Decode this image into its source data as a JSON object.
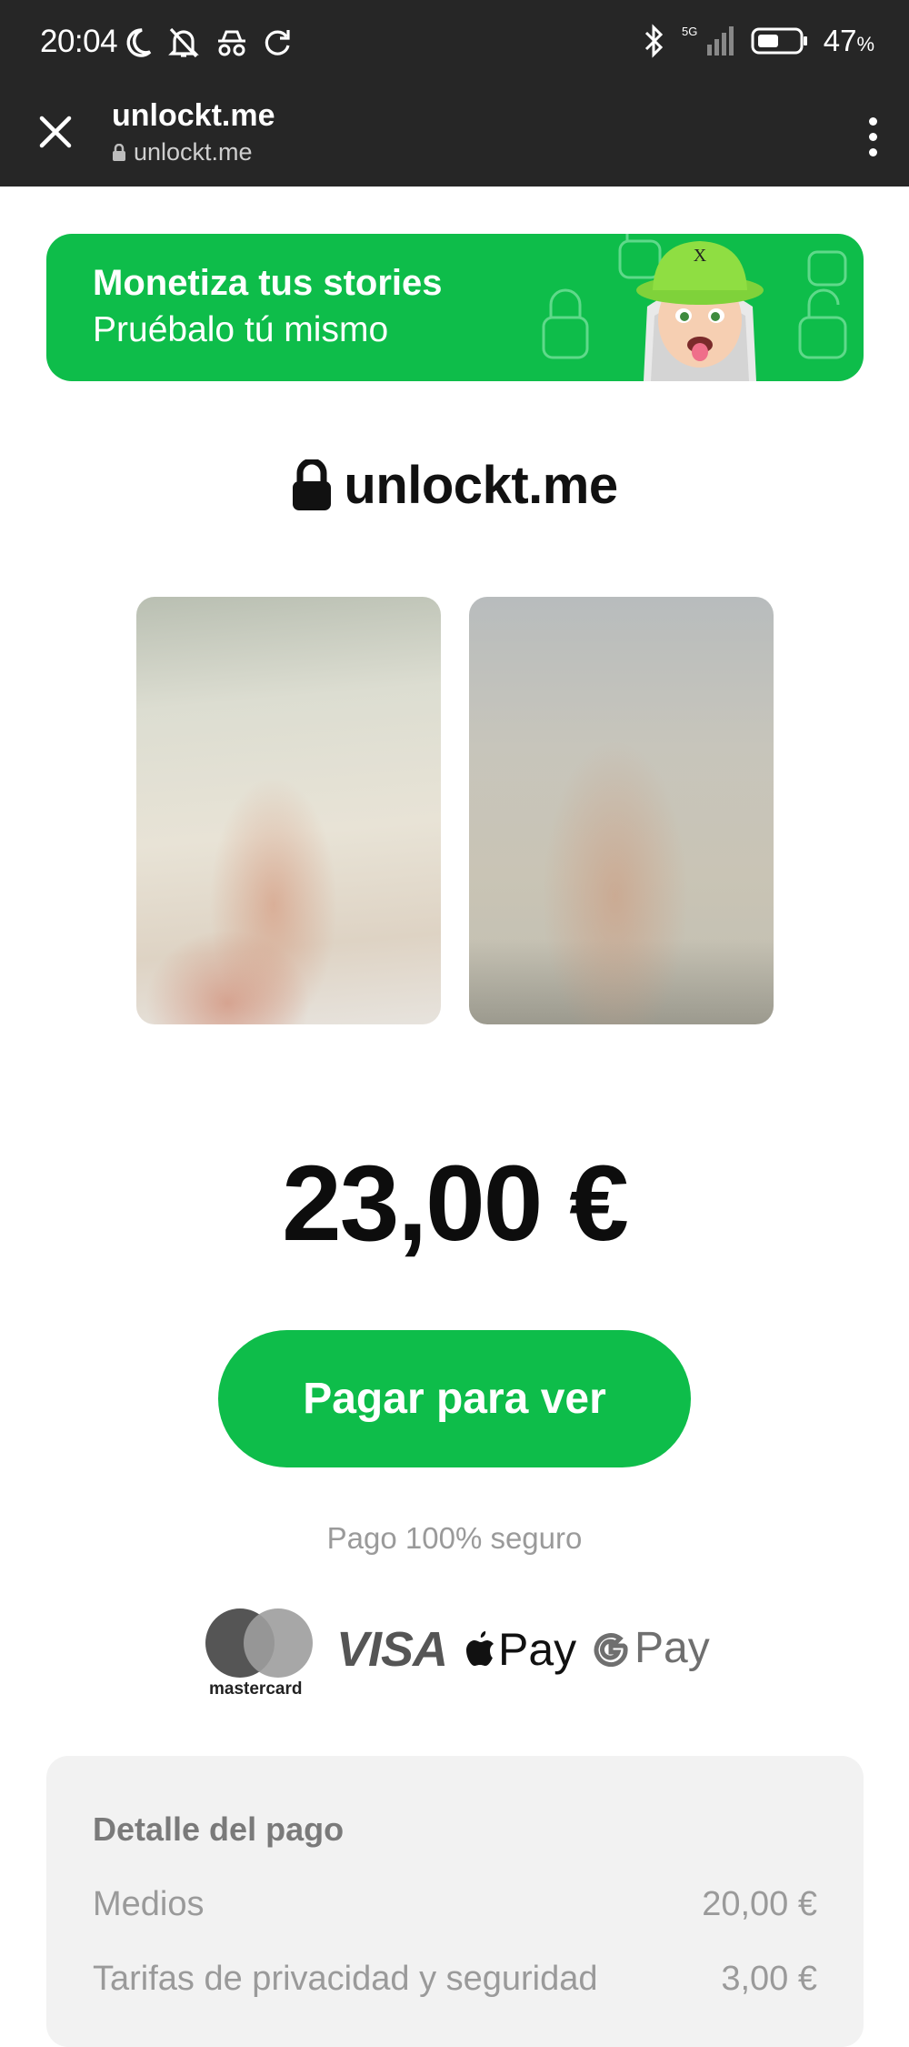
{
  "status_bar": {
    "time": "20:04",
    "network": "5G",
    "battery_percent": "47",
    "battery_unit": "%"
  },
  "browser": {
    "title": "unlockt.me",
    "url": "unlockt.me"
  },
  "banner": {
    "line1": "Monetiza tus stories",
    "line2": "Pruébalo tú mismo"
  },
  "brand": {
    "name": "unlockt.me"
  },
  "price": "23,00 €",
  "pay_button": "Pagar para ver",
  "secure_note": "Pago 100% seguro",
  "payment_methods": {
    "mastercard": "mastercard",
    "visa": "VISA",
    "apple_pay": "Pay",
    "google_pay": "Pay"
  },
  "details": {
    "title": "Detalle del pago",
    "rows": [
      {
        "label": "Medios",
        "value": "20,00 €"
      },
      {
        "label": "Tarifas de privacidad y seguridad",
        "value": "3,00 €"
      }
    ]
  },
  "colors": {
    "accent": "#0ebd4a",
    "dark_bar": "#262626"
  }
}
